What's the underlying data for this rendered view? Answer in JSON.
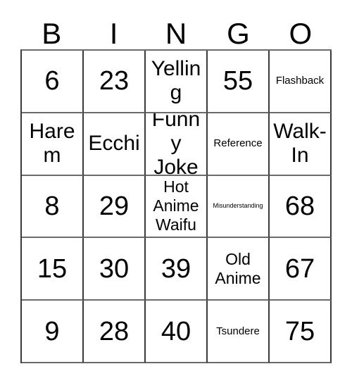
{
  "card": {
    "title": "BINGO",
    "columns": [
      "B",
      "I",
      "N",
      "G",
      "O"
    ],
    "rows": [
      [
        {
          "text": "6",
          "size": "size-xl"
        },
        {
          "text": "23",
          "size": "size-xl"
        },
        {
          "text": "Yelling",
          "size": "size-lg"
        },
        {
          "text": "55",
          "size": "size-xl"
        },
        {
          "text": "Flashback",
          "size": "size-sm"
        }
      ],
      [
        {
          "text": "Harem",
          "size": "size-lg"
        },
        {
          "text": "Ecchi",
          "size": "size-lg"
        },
        {
          "text": "Funny Joke",
          "size": "size-lg"
        },
        {
          "text": "Reference",
          "size": "size-sm"
        },
        {
          "text": "Walk-In",
          "size": "size-lg"
        }
      ],
      [
        {
          "text": "8",
          "size": "size-xl"
        },
        {
          "text": "29",
          "size": "size-xl"
        },
        {
          "text": "Hot Anime Waifu",
          "size": "size-md"
        },
        {
          "text": "Misunderstanding",
          "size": "size-xs"
        },
        {
          "text": "68",
          "size": "size-xl"
        }
      ],
      [
        {
          "text": "15",
          "size": "size-xl"
        },
        {
          "text": "30",
          "size": "size-xl"
        },
        {
          "text": "39",
          "size": "size-xl"
        },
        {
          "text": "Old Anime",
          "size": "size-md"
        },
        {
          "text": "67",
          "size": "size-xl"
        }
      ],
      [
        {
          "text": "9",
          "size": "size-xl"
        },
        {
          "text": "28",
          "size": "size-xl"
        },
        {
          "text": "40",
          "size": "size-xl"
        },
        {
          "text": "Tsundere",
          "size": "size-sm"
        },
        {
          "text": "75",
          "size": "size-xl"
        }
      ]
    ],
    "colors": {
      "background": "#ffffff",
      "text": "#000000",
      "grid_line": "#3a3a3a"
    }
  }
}
